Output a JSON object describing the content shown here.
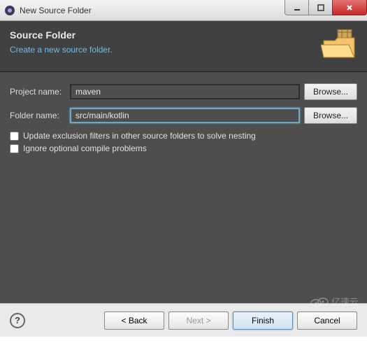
{
  "window": {
    "title": "New Source Folder"
  },
  "header": {
    "title": "Source Folder",
    "subtitle": "Create a new source folder."
  },
  "form": {
    "project_label": "Project name:",
    "project_value": "maven",
    "folder_label": "Folder name:",
    "folder_value": "src/main/kotlin",
    "browse_label": "Browse...",
    "update_exclusion_label": "Update exclusion filters in other source folders to solve nesting",
    "ignore_optional_label": "Ignore optional compile problems"
  },
  "buttons": {
    "back": "< Back",
    "next": "Next >",
    "finish": "Finish",
    "cancel": "Cancel"
  },
  "watermark": "亿速云"
}
